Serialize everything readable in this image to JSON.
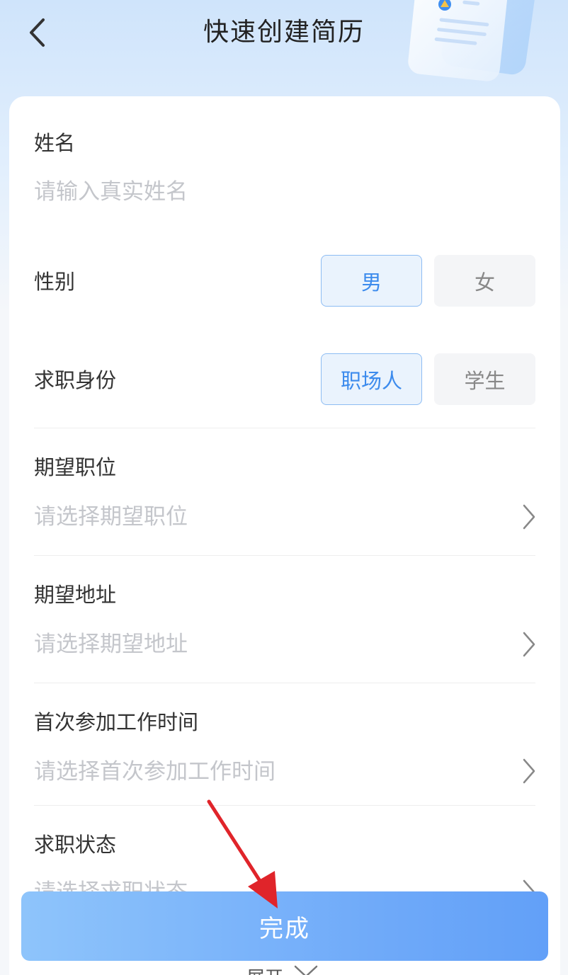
{
  "header": {
    "title": "快速创建简历"
  },
  "form": {
    "name": {
      "label": "姓名",
      "placeholder": "请输入真实姓名"
    },
    "gender": {
      "label": "性别",
      "options": [
        "男",
        "女"
      ],
      "selected": "男"
    },
    "identity": {
      "label": "求职身份",
      "options": [
        "职场人",
        "学生"
      ],
      "selected": "职场人"
    },
    "position": {
      "label": "期望职位",
      "placeholder": "请选择期望职位"
    },
    "address": {
      "label": "期望地址",
      "placeholder": "请选择期望地址"
    },
    "first_work": {
      "label": "首次参加工作时间",
      "placeholder": "请选择首次参加工作时间"
    },
    "job_status": {
      "label": "求职状态",
      "placeholder": "请选择求职状态"
    }
  },
  "footer": {
    "done_label": "完成",
    "expand_label": "展开"
  },
  "colors": {
    "accent": "#3c8bed",
    "button_gradient_start": "#8ec4fb",
    "button_gradient_end": "#62a0f8",
    "annotation_arrow": "#e0242a"
  },
  "icons": {
    "back": "chevron-left-icon",
    "row_arrow": "chevron-right-icon",
    "expand": "chevron-down-icon",
    "decoration": "resume-document-icon"
  }
}
